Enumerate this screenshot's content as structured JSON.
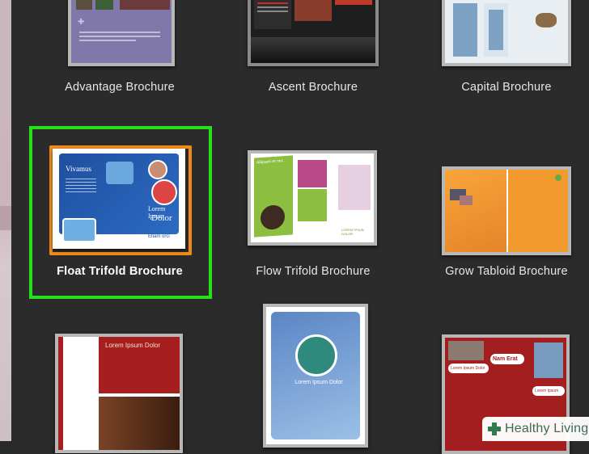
{
  "templates": [
    {
      "id": "advantage",
      "label": "Advantage Brochure",
      "selected": false
    },
    {
      "id": "ascent",
      "label": "Ascent Brochure",
      "selected": false
    },
    {
      "id": "capital",
      "label": "Capital Brochure",
      "selected": false
    },
    {
      "id": "float",
      "label": "Float Trifold Brochure",
      "selected": true,
      "thumb_texts": {
        "heading": "Vivamus",
        "title_1": "Lorem Ipsum",
        "title_2": "Dolor",
        "small_heading": "Etiam orci"
      }
    },
    {
      "id": "flow",
      "label": "Flow Trifold Brochure",
      "selected": false,
      "thumb_texts": {
        "heading": "Aliquam et nec",
        "footer": "LOREM IPSUM DOLOR"
      }
    },
    {
      "id": "grow",
      "label": "Grow Tabloid Brochure",
      "selected": false
    },
    {
      "id": "lorem1",
      "label": "",
      "selected": false,
      "thumb_texts": {
        "title": "Lorem Ipsum Dolor"
      }
    },
    {
      "id": "lorem2",
      "label": "",
      "selected": false,
      "thumb_texts": {
        "title": "Lorem Ipsum Dolor"
      }
    },
    {
      "id": "sports",
      "label": "",
      "selected": false,
      "thumb_texts": {
        "bubble_1": "Lorem Ipsum Dolor",
        "bubble_2": "Nam Erat",
        "bubble_3": "Lorem Ipsum"
      }
    }
  ],
  "watermark": {
    "brand": "Healthy Living"
  },
  "colors": {
    "selection": "#27e01a",
    "orange_frame": "#f28a1b",
    "background": "#2b2b2b"
  }
}
